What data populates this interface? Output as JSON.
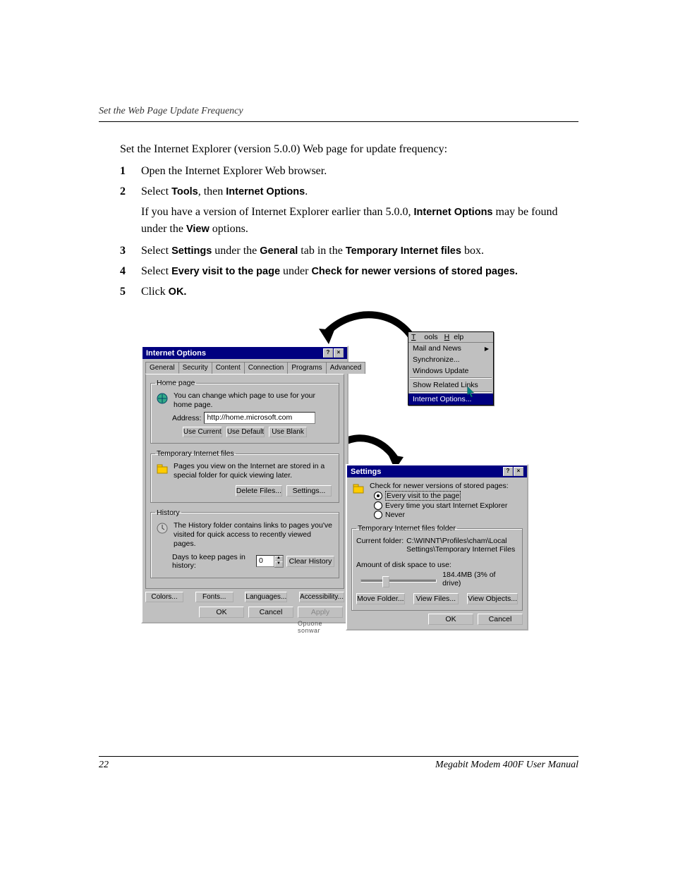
{
  "header": "Set the Web Page Update Frequency",
  "intro": "Set the Internet Explorer (version 5.0.0) Web page for update frequency:",
  "steps": {
    "s1": "Open the Internet Explorer Web browser.",
    "s2a": "Select ",
    "s2b": "Tools",
    "s2c": ", then ",
    "s2d": "Internet Options",
    "s2e": ".",
    "s2sub_a": "If you have a version of Internet Explorer earlier than 5.0.0, ",
    "s2sub_b": "Internet Options",
    "s2sub_c": " may be found under the ",
    "s2sub_d": "View",
    "s2sub_e": " options.",
    "s3a": "Select ",
    "s3b": "Settings",
    "s3c": " under the ",
    "s3d": "General",
    "s3e": " tab in the ",
    "s3f": "Temporary Internet files",
    "s3g": " box.",
    "s4a": "Select ",
    "s4b": "Every visit to the page",
    "s4c": " under ",
    "s4d": "Check for newer versions of stored pages.",
    "s5a": "Click ",
    "s5b": "OK."
  },
  "step_numbers": {
    "s1": "1",
    "s2": "2",
    "s3": "3",
    "s4": "4",
    "s5": "5"
  },
  "footer": {
    "page": "22",
    "title": "Megabit Modem 400F User Manual"
  },
  "toolsmenu": {
    "menubar": {
      "tools": "Tools",
      "help": "Help"
    },
    "items": {
      "mail": "Mail and News",
      "sync": "Synchronize...",
      "winupd": "Windows Update",
      "related": "Show Related Links",
      "iopt": "Internet Options..."
    }
  },
  "internet_options": {
    "title": "Internet Options",
    "tabs": {
      "general": "General",
      "security": "Security",
      "content": "Content",
      "connection": "Connection",
      "programs": "Programs",
      "advanced": "Advanced"
    },
    "homepage": {
      "legend": "Home page",
      "text": "You can change which page to use for your home page.",
      "address_label": "Address:",
      "address_value": "http://home.microsoft.com",
      "use_current": "Use Current",
      "use_default": "Use Default",
      "use_blank": "Use Blank"
    },
    "temp": {
      "legend": "Temporary Internet files",
      "text": "Pages you view on the Internet are stored in a special folder for quick viewing later.",
      "delete": "Delete Files...",
      "settings": "Settings..."
    },
    "history": {
      "legend": "History",
      "text": "The History folder contains links to pages you've visited for quick access to recently viewed pages.",
      "days_label": "Days to keep pages in history:",
      "days_value": "0",
      "clear": "Clear History"
    },
    "bottom": {
      "colors": "Colors...",
      "fonts": "Fonts...",
      "languages": "Languages...",
      "accessibility": "Accessibility..."
    },
    "okrow": {
      "ok": "OK",
      "cancel": "Cancel",
      "apply": "Apply"
    },
    "truncated": "Opuone sonwar"
  },
  "settings_dialog": {
    "title": "Settings",
    "check_label": "Check for newer versions of stored pages:",
    "radios": {
      "every": "Every visit to the page",
      "start": "Every time you start Internet Explorer",
      "never": "Never"
    },
    "folder_legend": "Temporary Internet files folder",
    "current_label": "Current folder:",
    "current_value": "C:\\WINNT\\Profiles\\cham\\Local Settings\\Temporary Internet Files",
    "disk_label": "Amount of disk space to use:",
    "disk_value": "184.4MB (3% of drive)",
    "btns": {
      "move": "Move Folder...",
      "viewf": "View Files...",
      "viewo": "View Objects..."
    },
    "okrow": {
      "ok": "OK",
      "cancel": "Cancel"
    }
  }
}
